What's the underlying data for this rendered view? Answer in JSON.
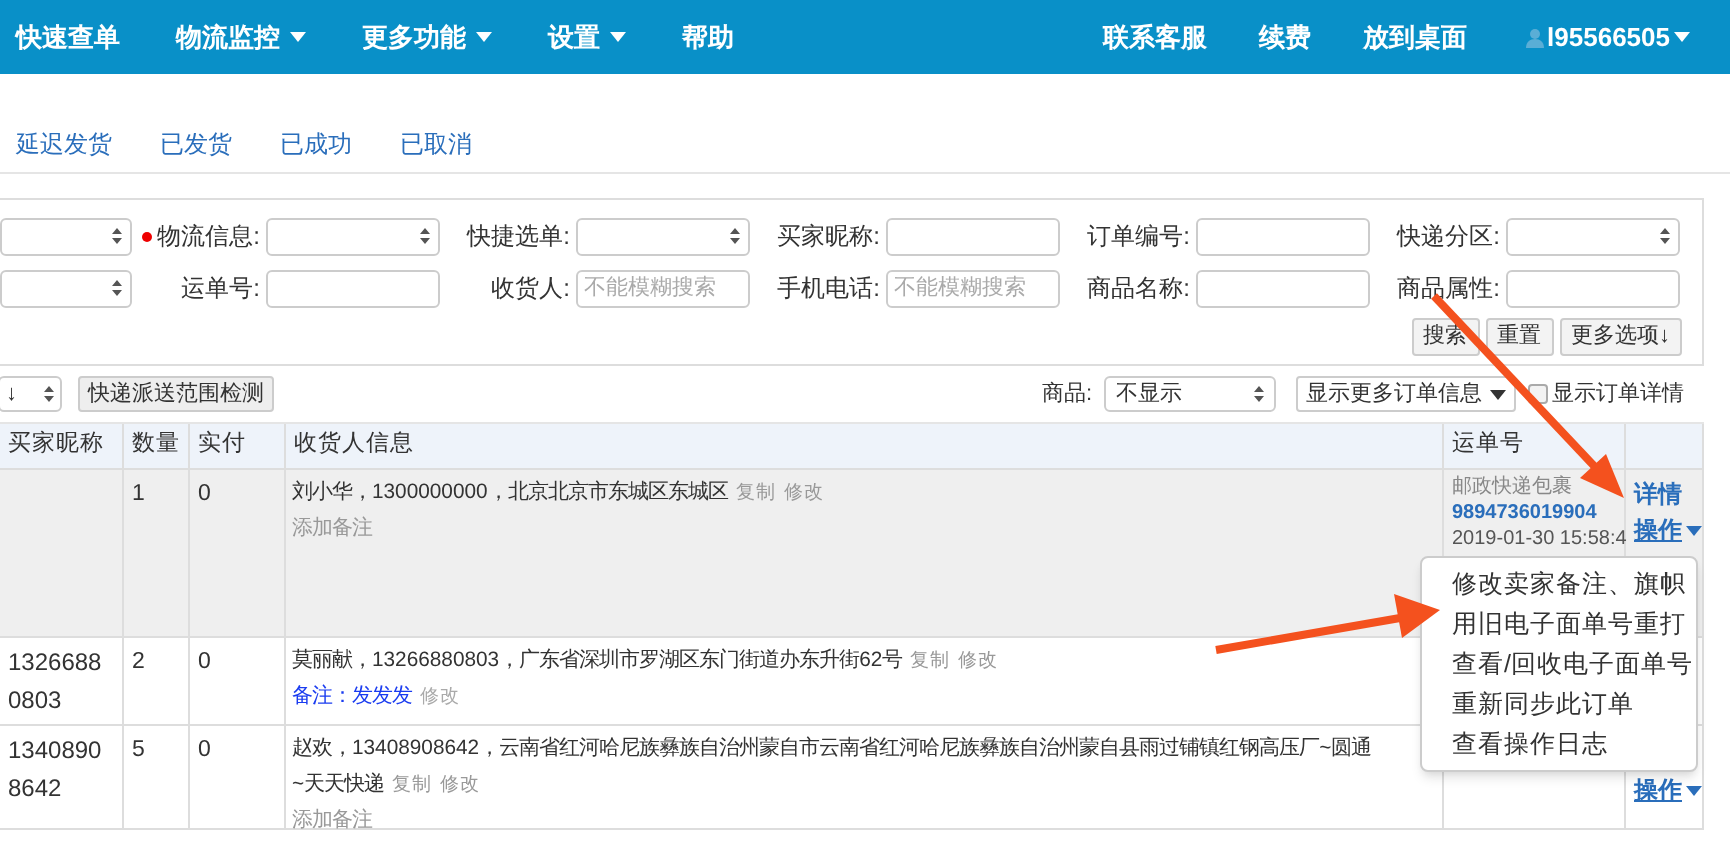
{
  "nav": {
    "left": [
      {
        "label": "快速查单",
        "caret": false
      },
      {
        "label": "物流监控",
        "caret": true
      },
      {
        "label": "更多功能",
        "caret": true
      },
      {
        "label": "设置",
        "caret": true
      },
      {
        "label": "帮助",
        "caret": false
      }
    ],
    "right": [
      {
        "label": "联系客服"
      },
      {
        "label": "续费"
      },
      {
        "label": "放到桌面"
      }
    ],
    "user": "l95566505"
  },
  "tabs": [
    {
      "label": "延迟发货",
      "selected": false
    },
    {
      "label": "已发货",
      "selected": false
    },
    {
      "label": "已成功",
      "selected": false
    },
    {
      "label": "已取消",
      "selected": false
    }
  ],
  "filters": [
    [
      {
        "kind": "select"
      },
      {
        "kind": "select",
        "label": "物流信息:",
        "required": true
      },
      {
        "kind": "select",
        "label": "快捷选单:",
        "required": false
      },
      {
        "kind": "input",
        "label": "买家昵称:",
        "required": false
      },
      {
        "kind": "input",
        "label": "订单编号:",
        "required": false
      },
      {
        "kind": "select",
        "label": "快递分区:",
        "required": false
      }
    ],
    [
      {
        "kind": "select"
      },
      {
        "kind": "input",
        "label": "运单号:",
        "required": false
      },
      {
        "kind": "input",
        "label": "收货人:",
        "placeholder": "不能模糊搜索",
        "required": false
      },
      {
        "kind": "input",
        "label": "手机电话:",
        "placeholder": "不能模糊搜索",
        "required": false
      },
      {
        "kind": "input",
        "label": "商品名称:",
        "required": false
      },
      {
        "kind": "input",
        "label": "商品属性:",
        "required": false
      }
    ]
  ],
  "filter_buttons": [
    "搜索",
    "重置",
    "更多选项↓"
  ],
  "toolbar": {
    "sort_select": "↓",
    "check_button": "快递派送范围检测",
    "goods_label": "商品:",
    "goods_select": "不显示",
    "more_info": "显示更多订单信息",
    "detail_checkbox": {
      "label": "显示订单详情",
      "checked": false
    }
  },
  "table": {
    "columns": [
      "买家昵称",
      "数量",
      "实付",
      "收货人信息",
      "运单号",
      null
    ],
    "rows": [
      {
        "qty": "1",
        "paid": "0",
        "recipient": {
          "lines": [
            "刘小华，1300000000，北京北京市东城区东城区"
          ],
          "copy": "复制",
          "edit": "修改",
          "note": "添加备注",
          "note_set": false
        },
        "waybill": {
          "carrier": "邮政快递包裹",
          "number": "9894736019904",
          "time": "2019-01-30 15:58:4"
        },
        "actions": [
          "详情",
          "操作"
        ],
        "highlighted": true
      },
      {
        "buyer": "13266880803",
        "qty": "2",
        "paid": "0",
        "recipient": {
          "lines": [
            "莫丽献，13266880803，广东省深圳市罗湖区东门街道办东升街62号"
          ],
          "copy": "复制",
          "edit": "修改",
          "note": "备注：发发发",
          "note_set": true,
          "note_edit": "修改"
        },
        "actions": [],
        "highlighted": false
      },
      {
        "buyer": "13408908642",
        "qty": "5",
        "paid": "0",
        "recipient": {
          "lines": [
            "赵欢，13408908642，云南省红河哈尼族彝族自治州蒙自市云南省红河哈尼族彝族自治州蒙自县雨过铺镇红钢高压厂~圆通",
            "~天天快递"
          ],
          "copy": "复制",
          "edit": "修改",
          "note": "添加备注",
          "note_set": false
        },
        "actions": [
          "操作"
        ],
        "highlighted": false
      }
    ]
  },
  "menu": [
    "修改卖家备注、旗帜",
    "用旧电子面单号重打",
    "查看/回收电子面单号",
    "重新同步此订单",
    "查看操作日志"
  ]
}
